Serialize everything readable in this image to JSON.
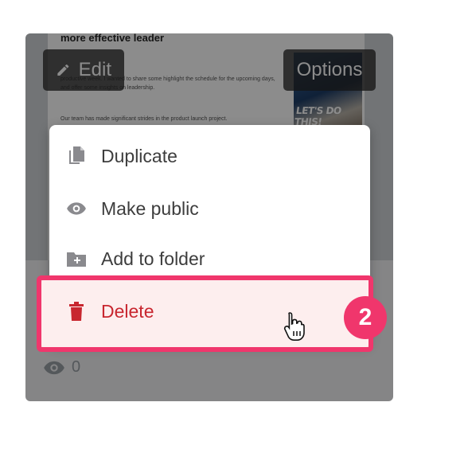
{
  "card": {
    "doc_title": "more effective leader",
    "doc_para1": "productive week. I wanted to share some highlight the schedule for the upcoming days, and offer some insights on leadership.",
    "doc_para2": "Our team has made significant strides in the product launch project.",
    "image_text": "LET'S DO THIS!",
    "views_count": "0"
  },
  "buttons": {
    "edit": "Edit",
    "options": "Options"
  },
  "menu": {
    "items": [
      {
        "label": "Duplicate",
        "icon": "duplicate-icon"
      },
      {
        "label": "Make public",
        "icon": "eye-icon"
      },
      {
        "label": "Add to folder",
        "icon": "folder-add-icon"
      },
      {
        "label": "Delete",
        "icon": "trash-icon"
      }
    ]
  },
  "step_badge": "2",
  "colors": {
    "highlight": "#f0366c",
    "delete_text": "#c8262f",
    "badge": "#f0366c"
  }
}
